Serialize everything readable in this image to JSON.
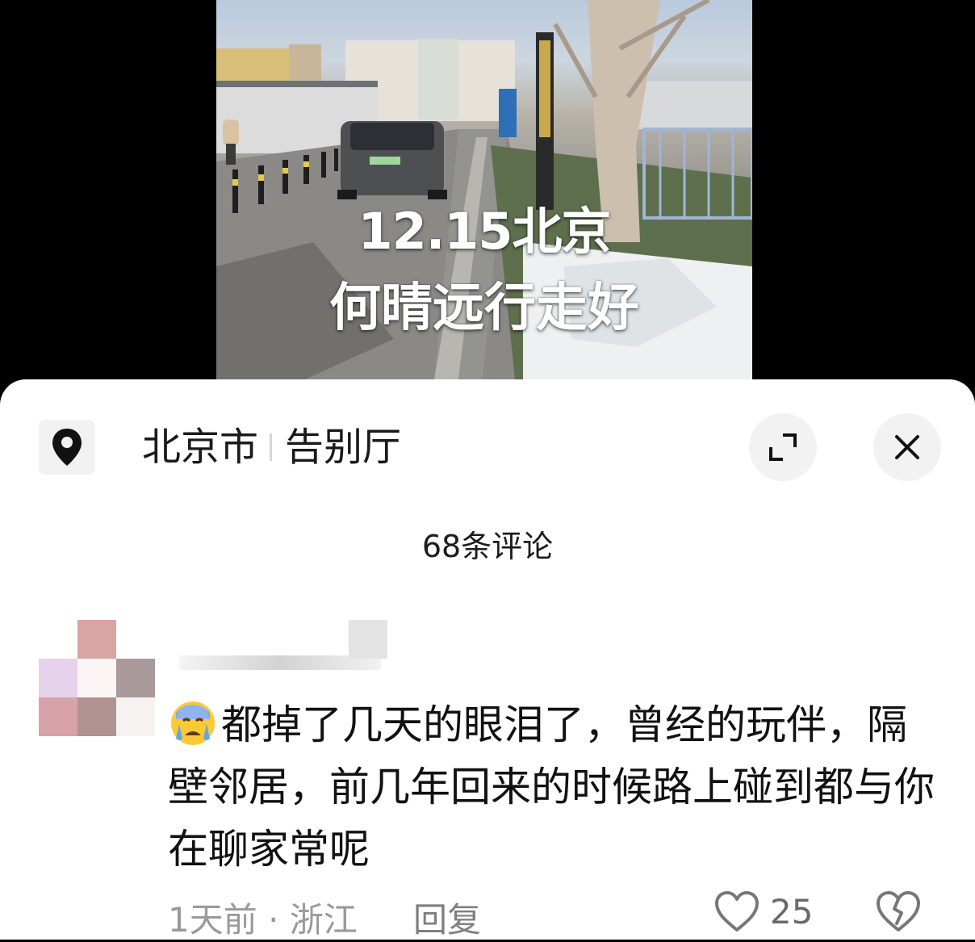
{
  "video": {
    "overlay_line1": "12.15北京",
    "overlay_line2": "何晴远行走好"
  },
  "sheet": {
    "location_icon": "map-pin-icon",
    "location_city": "北京市",
    "location_place": "告别厅",
    "expand_icon": "expand-icon",
    "close_icon": "close-icon",
    "comment_count": "68条评论"
  },
  "comment": {
    "emoji": "crying-face-emoji",
    "text": "都掉了几天的眼泪了，曾经的玩伴，隔壁邻居，前几年回来的时候路上碰到都与你在聊家常呢",
    "meta": "1天前 · 浙江",
    "reply_label": "回复",
    "like_icon": "heart-icon",
    "like_count": "25",
    "dislike_icon": "broken-heart-icon"
  },
  "colors": {
    "sheet_bg": "#ffffff",
    "button_bg": "#f2f2f2",
    "meta_text": "#9a9a9a"
  }
}
